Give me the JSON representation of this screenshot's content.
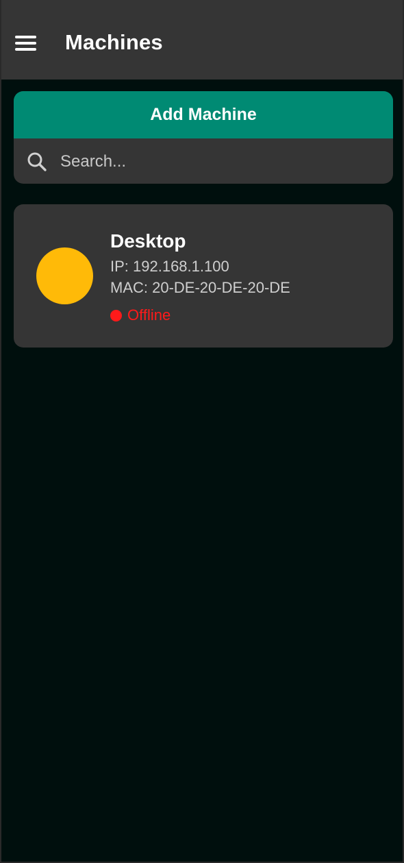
{
  "app_bar": {
    "title": "Machines",
    "menu_icon": "hamburger-menu-icon"
  },
  "top_panel": {
    "add_button_label": "Add Machine",
    "search": {
      "icon": "search-icon",
      "placeholder": "Search...",
      "value": ""
    }
  },
  "machines": [
    {
      "name": "Desktop",
      "ip": "IP: 192.168.1.100",
      "mac": "MAC: 20-DE-20-DE-20-DE",
      "status": "Offline",
      "status_color": "#ff1a1a",
      "avatar_color": "#ffba08"
    }
  ],
  "colors": {
    "background": "#000f0d",
    "surface": "#353535",
    "accent": "#008a73"
  }
}
